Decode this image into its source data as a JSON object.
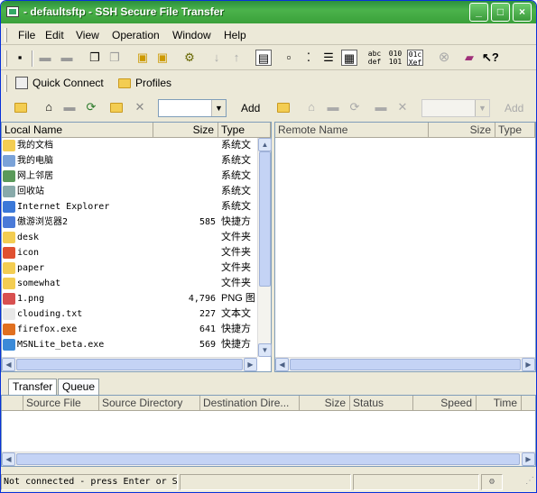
{
  "window": {
    "title": "- defaultsftp - SSH Secure File Transfer"
  },
  "menu": [
    "File",
    "Edit",
    "View",
    "Operation",
    "Window",
    "Help"
  ],
  "quickbar": {
    "quick_connect": "Quick Connect",
    "profiles": "Profiles"
  },
  "local": {
    "add_label": "Add",
    "columns": [
      "Local Name",
      "Size",
      "Type"
    ],
    "files": [
      {
        "name": "我的文档",
        "size": "",
        "type": "系统文",
        "color": "#f3cd52"
      },
      {
        "name": "我的电脑",
        "size": "",
        "type": "系统文",
        "color": "#7aa2d8"
      },
      {
        "name": "网上邻居",
        "size": "",
        "type": "系统文",
        "color": "#5a9a5a"
      },
      {
        "name": "回收站",
        "size": "",
        "type": "系统文",
        "color": "#8aa"
      },
      {
        "name": "Internet Explorer",
        "size": "",
        "type": "系统文",
        "color": "#3b78d8"
      },
      {
        "name": "傲游浏览器2",
        "size": "585",
        "type": "快捷方",
        "color": "#4a7ad8"
      },
      {
        "name": "desk",
        "size": "",
        "type": "文件夹",
        "color": "#f3cd52"
      },
      {
        "name": "icon",
        "size": "",
        "type": "文件夹",
        "color": "#e05030"
      },
      {
        "name": "paper",
        "size": "",
        "type": "文件夹",
        "color": "#f3cd52"
      },
      {
        "name": "somewhat",
        "size": "",
        "type": "文件夹",
        "color": "#f3cd52"
      },
      {
        "name": "1.png",
        "size": "4,796",
        "type": "PNG 图",
        "color": "#d85050"
      },
      {
        "name": "clouding.txt",
        "size": "227",
        "type": "文本文",
        "color": "#e8e8e8"
      },
      {
        "name": "firefox.exe",
        "size": "641",
        "type": "快捷方",
        "color": "#e07020"
      },
      {
        "name": "MSNLite_beta.exe",
        "size": "569",
        "type": "快捷方",
        "color": "#3a8ad8"
      }
    ]
  },
  "remote": {
    "add_label": "Add",
    "columns": [
      "Remote Name",
      "Size",
      "Type"
    ]
  },
  "transfer": {
    "tabs": [
      "Transfer",
      "Queue"
    ],
    "columns": [
      "Source File",
      "Source Directory",
      "Destination Dire...",
      "Size",
      "Status",
      "Speed",
      "Time"
    ]
  },
  "status": {
    "text": "Not connected - press Enter or S"
  }
}
